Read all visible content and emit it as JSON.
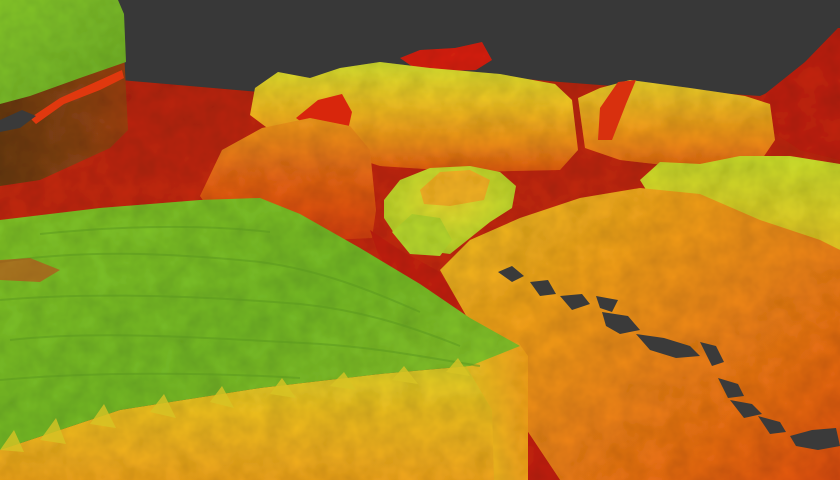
{
  "scene": {
    "background_color": "#383838",
    "colormap": [
      "#c81e0a",
      "#e04a10",
      "#f07a12",
      "#f5b020",
      "#e8d82a",
      "#a8dc2c",
      "#7cc628"
    ],
    "hole_color": "#3a3a3a"
  }
}
